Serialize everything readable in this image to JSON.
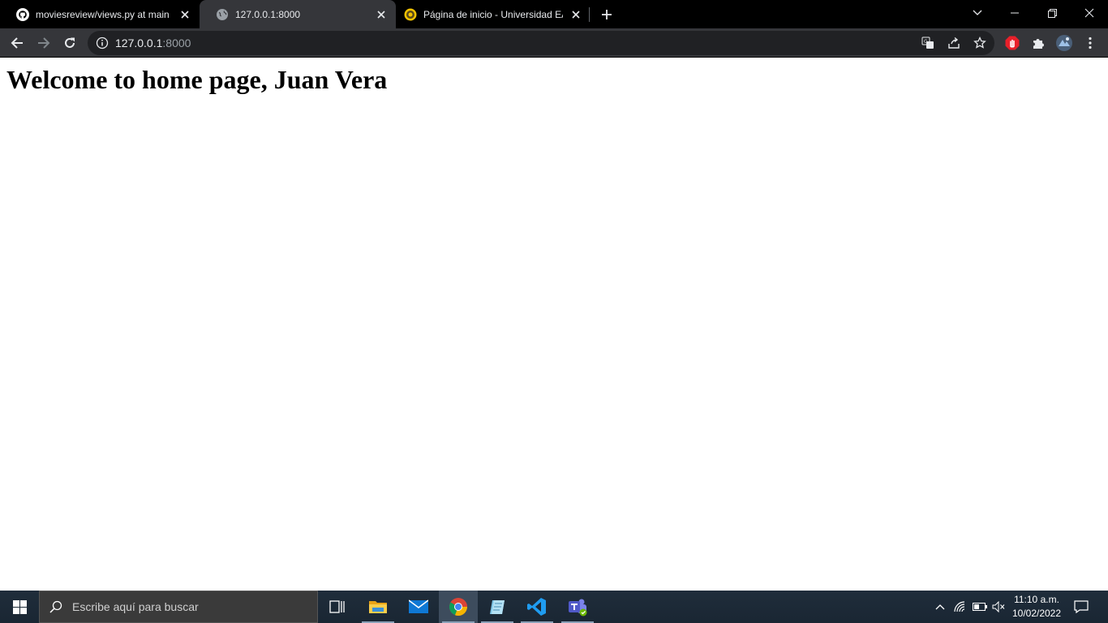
{
  "browser": {
    "tabs": [
      {
        "title": "moviesreview/views.py at main · ",
        "favicon": "github-icon",
        "active": false
      },
      {
        "title": "127.0.0.1:8000",
        "favicon": "globe-icon",
        "active": true
      },
      {
        "title": "Página de inicio - Universidad EA",
        "favicon": "university-icon",
        "active": false
      }
    ],
    "address": {
      "host": "127.0.0.1",
      "port": ":8000"
    },
    "colors": {
      "tabstrip": "#000000",
      "toolbar": "#35363a",
      "omnibox": "#202124",
      "text": "#e8eaed"
    }
  },
  "page": {
    "heading": "Welcome to home page, Juan Vera"
  },
  "taskbar": {
    "search_placeholder": "Escribe aquí para buscar",
    "apps": [
      "task-view-icon",
      "file-explorer-icon",
      "mail-icon",
      "chrome-icon",
      "notes-icon",
      "vscode-icon",
      "teams-icon"
    ],
    "clock": {
      "time": "11:10 a.m.",
      "date": "10/02/2022"
    }
  }
}
